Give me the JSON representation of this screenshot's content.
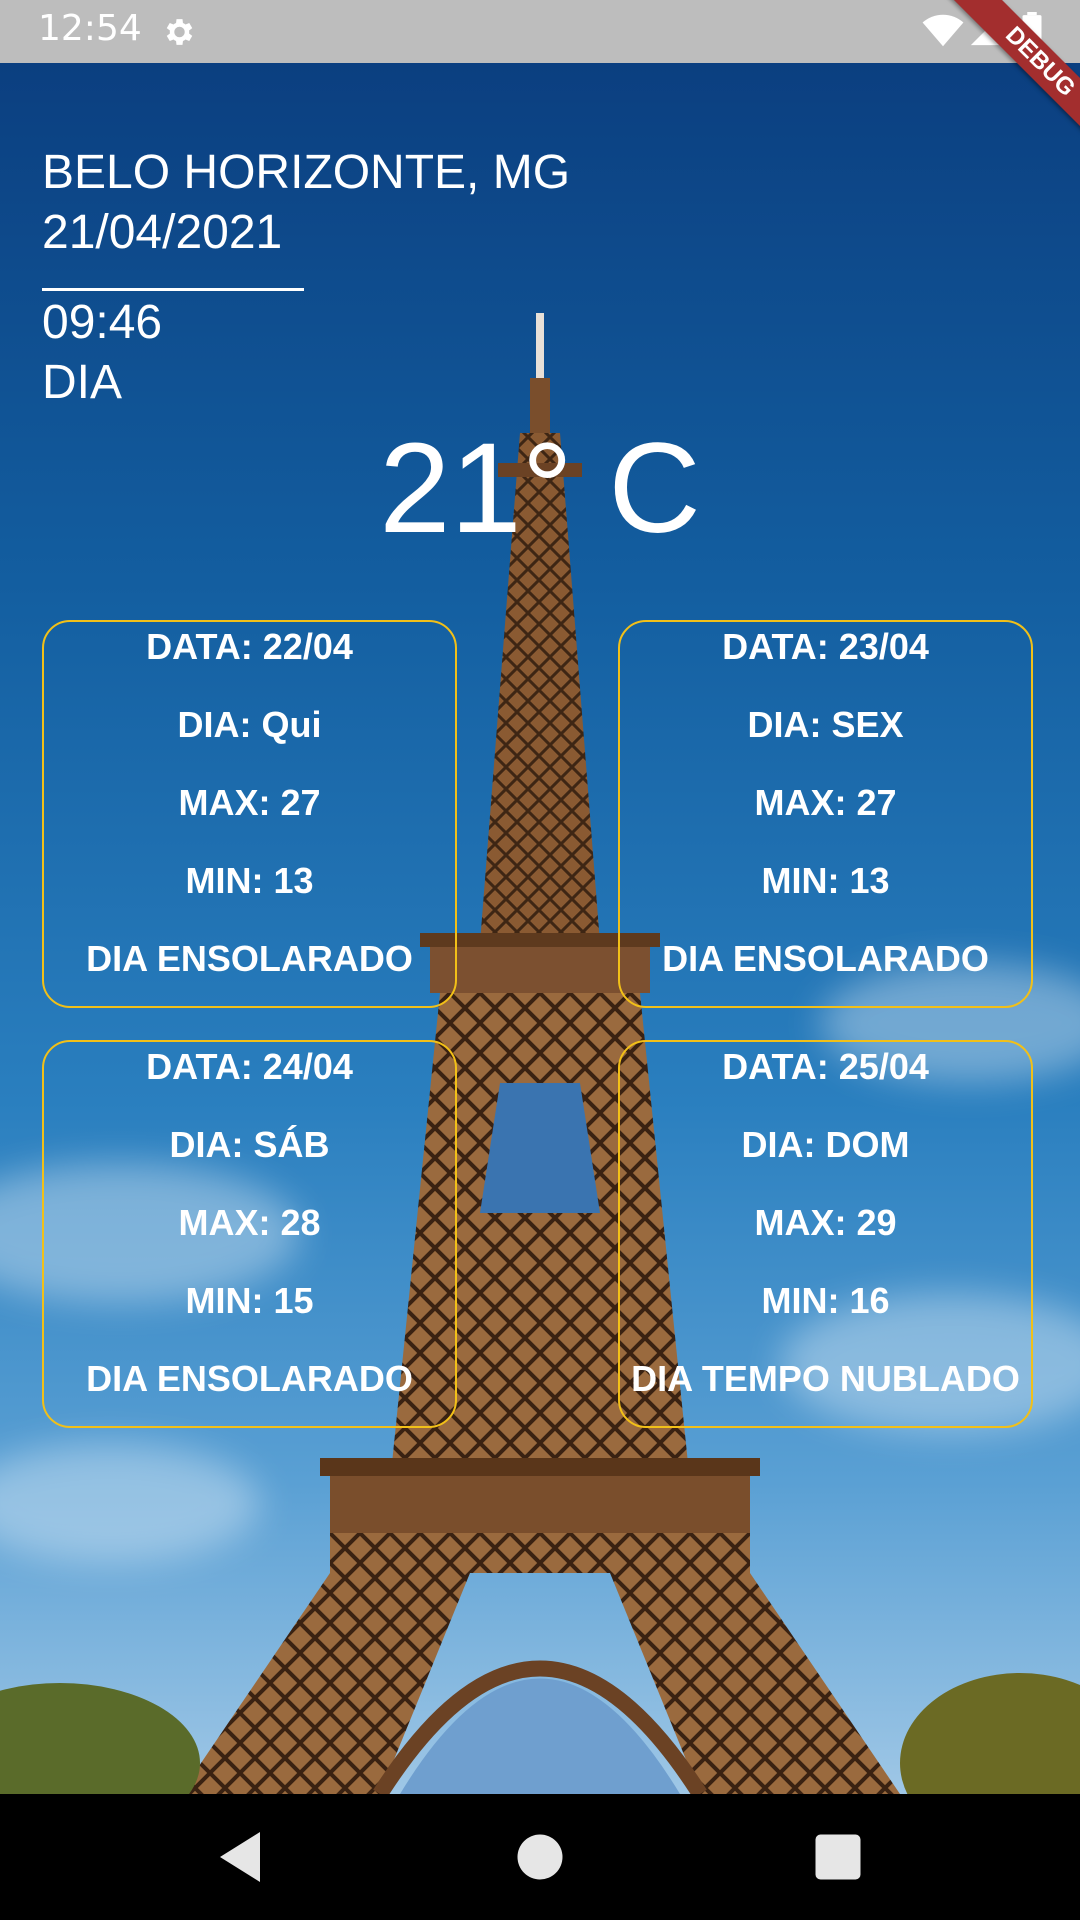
{
  "status_bar": {
    "time": "12:54",
    "icons": [
      "gear-icon",
      "wifi-icon",
      "signal-icon",
      "battery-icon"
    ]
  },
  "debug_banner": "DEBUG",
  "header": {
    "city": "BELO HORIZONTE, MG",
    "date": "21/04/2021",
    "time": "09:46",
    "period": "DIA"
  },
  "current_temperature": "21° C",
  "forecast": [
    {
      "data": "DATA: 22/04",
      "dia": "DIA: Qui",
      "max": "MAX: 27",
      "min": "MIN: 13",
      "desc": "DIA ENSOLARADO"
    },
    {
      "data": "DATA: 23/04",
      "dia": "DIA: SEX",
      "max": "MAX: 27",
      "min": "MIN: 13",
      "desc": "DIA ENSOLARADO"
    },
    {
      "data": "DATA: 24/04",
      "dia": "DIA: SÁB",
      "max": "MAX: 28",
      "min": "MIN: 15",
      "desc": "DIA ENSOLARADO"
    },
    {
      "data": "DATA: 25/04",
      "dia": "DIA: DOM",
      "max": "MAX: 29",
      "min": "MIN: 16",
      "desc": "DIA TEMPO NUBLADO"
    }
  ],
  "colors": {
    "card_border": "#f2c018",
    "text": "#ffffff",
    "sky_top": "#0b3f80",
    "debug_banner": "#a32e2e"
  },
  "nav_bar": {
    "buttons": [
      "back-icon",
      "home-icon",
      "recents-icon"
    ]
  }
}
